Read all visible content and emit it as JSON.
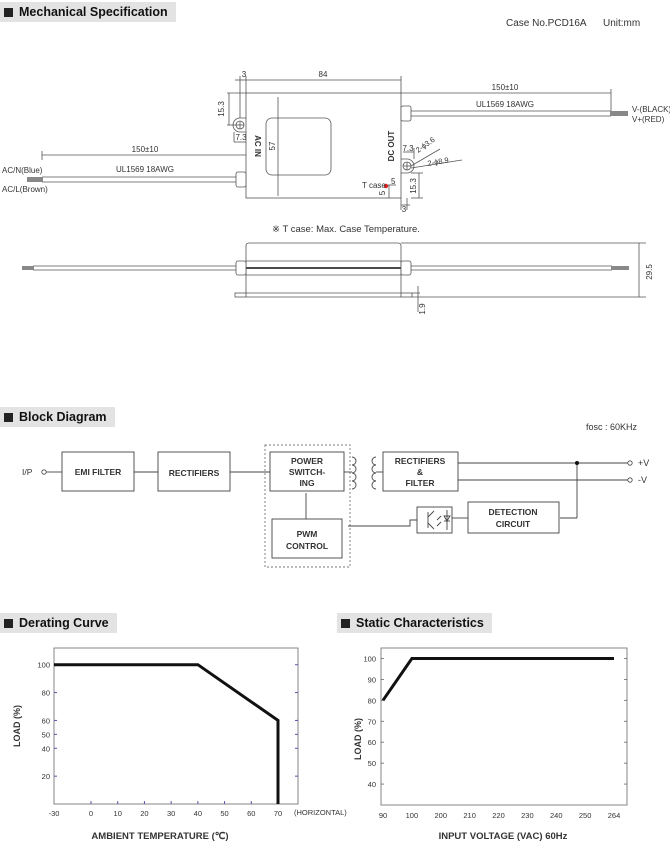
{
  "sections": {
    "mechanical": "Mechanical Specification",
    "block": "Block Diagram",
    "derating": "Derating Curve",
    "static": "Static Characteristics"
  },
  "mechanical": {
    "case_no": "Case No.PCD16A",
    "unit": "Unit:mm",
    "dim_width": "84",
    "dim_height": "57",
    "dim_tab": "3",
    "dim_tab_bottom": "3",
    "dim_hole_y_left": "15.3",
    "dim_hole_x_left": "7.3",
    "dim_hole_x_right": "7.3",
    "dim_hole_y_right": "15.3",
    "dim_hole_small": "2-ϕ3.6",
    "dim_hole_large": "2-ϕ8.9",
    "dim_tcase_x": "5",
    "dim_tcase_y": "5",
    "tcase_label": "T case",
    "ac_in_label": "AC IN",
    "dc_out_label": "DC OUT",
    "cable_in_length": "150±10",
    "cable_in_type": "UL1569 18AWG",
    "cable_out_length": "150±10",
    "cable_out_type": "UL1569 18AWG",
    "acn_label": "AC/N(Blue)",
    "acl_label": "AC/L(Brown)",
    "vneg_label": "V-(BLACK)",
    "vpos_label": "V+(RED)",
    "tcase_note": "※ T case: Max. Case Temperature.",
    "dim_side_height": "29.5",
    "dim_flange": "1.9"
  },
  "block_diagram": {
    "fosc": "fosc : 60KHz",
    "input_label": "I/P",
    "emi_filter": "EMI FILTER",
    "rectifiers": "RECTIFIERS",
    "power_switching": [
      "POWER",
      "SWITCH-",
      "ING"
    ],
    "pwm_control": [
      "PWM",
      "CONTROL"
    ],
    "rect_filter": [
      "RECTIFIERS",
      "&",
      "FILTER"
    ],
    "detection": [
      "DETECTION",
      "CIRCUIT"
    ],
    "out_pos": "+V",
    "out_neg": "-V"
  },
  "chart_data": [
    {
      "type": "line",
      "title": "Derating Curve",
      "xlabel": "AMBIENT TEMPERATURE (℃)",
      "ylabel": "LOAD (%)",
      "x_ticks": [
        "-30",
        "0",
        "10",
        "20",
        "30",
        "40",
        "50",
        "60",
        "70"
      ],
      "x_tick_values": [
        -30,
        0,
        10,
        20,
        30,
        40,
        50,
        60,
        70
      ],
      "x_suffix": "(HORIZONTAL)",
      "y_ticks": [
        "100",
        "80",
        "60",
        "50",
        "40",
        "20"
      ],
      "y_tick_values": [
        100,
        80,
        60,
        50,
        40,
        20
      ],
      "ylim": [
        0,
        112
      ],
      "series": [
        {
          "name": "Load",
          "x": [
            -30,
            40,
            70,
            70
          ],
          "y": [
            100,
            100,
            60,
            0
          ]
        }
      ]
    },
    {
      "type": "line",
      "title": "Static Characteristics",
      "xlabel": "INPUT VOLTAGE (VAC) 60Hz",
      "ylabel": "LOAD (%)",
      "x_ticks": [
        "90",
        "100",
        "200",
        "210",
        "220",
        "230",
        "240",
        "250",
        "264"
      ],
      "y_ticks": [
        "100",
        "90",
        "80",
        "70",
        "60",
        "50",
        "40"
      ],
      "y_tick_values": [
        100,
        90,
        80,
        70,
        60,
        50,
        40
      ],
      "ylim": [
        30,
        105
      ],
      "series": [
        {
          "name": "Load",
          "x": [
            "90",
            "100",
            "264"
          ],
          "y": [
            80,
            100,
            100
          ]
        }
      ]
    }
  ]
}
